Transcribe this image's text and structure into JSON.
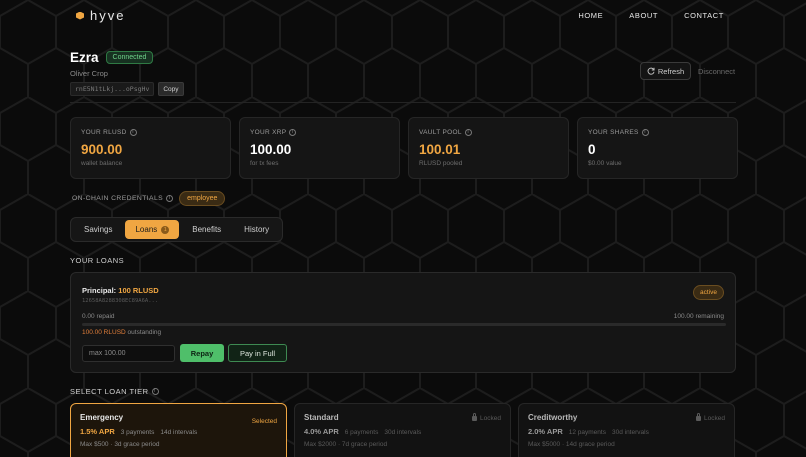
{
  "brand": {
    "name": "hyve",
    "icon": "hexagon-logo-icon",
    "accent": "#f0a642"
  },
  "nav": {
    "home": "HOME",
    "about": "ABOUT",
    "contact": "CONTACT"
  },
  "user": {
    "name": "Ezra",
    "status": "Connected",
    "org": "Oliver Crop",
    "address": "rnE5N1tLkj...oPsgHv",
    "copy_label": "Copy"
  },
  "actions": {
    "refresh": "Refresh",
    "refresh_icon": "refresh-icon",
    "disconnect": "Disconnect"
  },
  "stats": [
    {
      "label": "YOUR RLUSD",
      "value": "900.00",
      "sub": "wallet balance"
    },
    {
      "label": "YOUR XRP",
      "value": "100.00",
      "sub": "for tx fees"
    },
    {
      "label": "VAULT POOL",
      "value": "100.01",
      "sub": "RLUSD pooled"
    },
    {
      "label": "YOUR SHARES",
      "value": "0",
      "sub": "$0.00 value"
    }
  ],
  "credentials": {
    "label": "ON-CHAIN CREDENTIALS",
    "badge": "employee"
  },
  "tabs": {
    "savings": "Savings",
    "loans": "Loans",
    "loans_count": "1",
    "benefits": "Benefits",
    "history": "History"
  },
  "loans": {
    "section_title": "YOUR LOANS",
    "principal_label": "Principal:",
    "principal_value": "100 RLUSD",
    "hash": "12658A8288308EC89A6A...",
    "status": "active",
    "repaid": "0.00 repaid",
    "remaining": "100.00 remaining",
    "progress_fraction": 0.0,
    "outstanding_amount": "100.00 RLUSD",
    "outstanding_label": "outstanding",
    "repay_placeholder": "max 100.00",
    "repay_button": "Repay",
    "pay_full_button": "Pay in Full"
  },
  "tiers": {
    "section_title": "SELECT LOAN TIER",
    "items": [
      {
        "name": "Emergency",
        "tag": "Selected",
        "apr": "1.5% APR",
        "payments": "3 payments",
        "intervals": "14d intervals",
        "limits": "Max $500 · 3d grace period"
      },
      {
        "name": "Standard",
        "tag": "Locked",
        "apr": "4.0% APR",
        "payments": "6 payments",
        "intervals": "30d intervals",
        "limits": "Max $2000 · 7d grace period"
      },
      {
        "name": "Creditworthy",
        "tag": "Locked",
        "apr": "2.0% APR",
        "payments": "12 payments",
        "intervals": "30d intervals",
        "limits": "Max $5000 · 14d grace period"
      }
    ]
  }
}
